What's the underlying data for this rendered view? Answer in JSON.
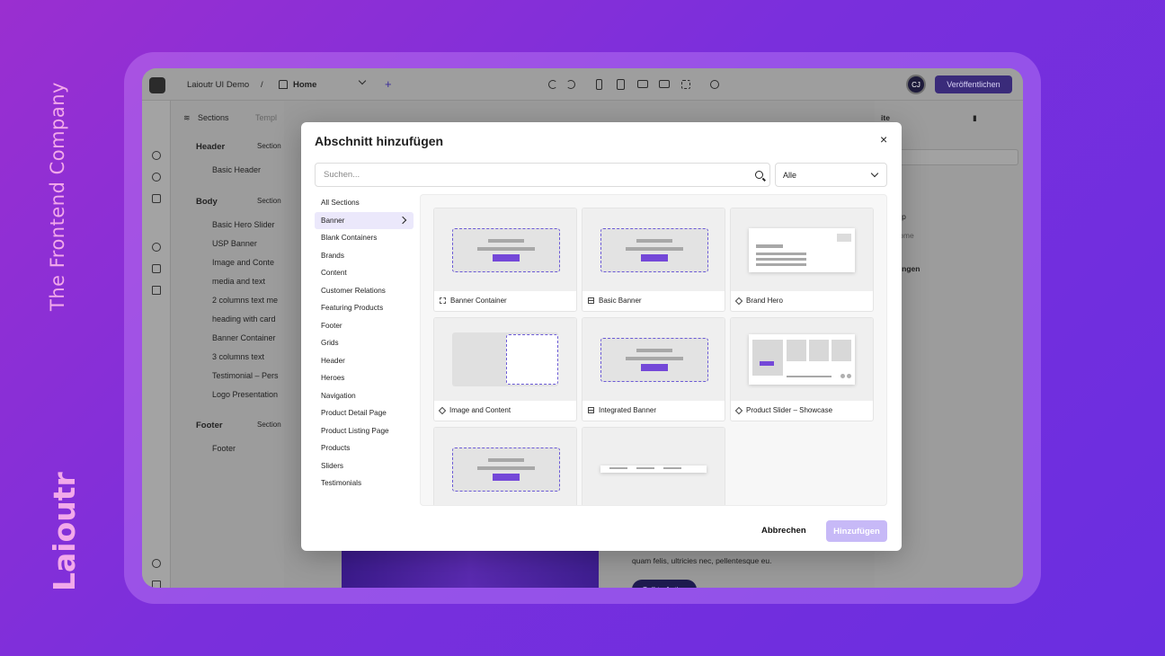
{
  "side": {
    "company": "The Frontend Company",
    "brand": "Laioutr"
  },
  "topbar": {
    "project": "Laioutr UI Demo",
    "separator": "/",
    "page": "Home",
    "add": "+",
    "avatar": "CJ",
    "publish": "Veröffentlichen"
  },
  "tree": {
    "tabs": [
      "Sections",
      "Templ"
    ],
    "sections": [
      {
        "title": "Header",
        "add": "Section",
        "items": [
          "Basic Header"
        ]
      },
      {
        "title": "Body",
        "add": "Section",
        "items": [
          "Basic Hero Slider",
          "USP Banner",
          "Image and Conte",
          "media and text",
          "2 columns text me",
          "heading with card",
          "Banner Container",
          "3 columns text",
          "Testimonial – Pers",
          "Logo Presentation"
        ]
      },
      {
        "title": "Footer",
        "add": "Section",
        "items": [
          "Footer"
        ]
      }
    ]
  },
  "rightpanel": {
    "title": "ite",
    "name_label": "me",
    "name_value": "ome",
    "url_label": "L",
    "type_label": "ntentyp",
    "type_value": "Home",
    "conditions": "dingungen",
    "seo": "O"
  },
  "canvas": {
    "text": "quam felis, ultricies nec, pellentesque eu.",
    "cta": "Call to Action"
  },
  "modal": {
    "title": "Abschnitt hinzufügen",
    "close": "×",
    "search_placeholder": "Suchen...",
    "filter": "Alle",
    "categories": [
      "All Sections",
      "Banner",
      "Blank Containers",
      "Brands",
      "Content",
      "Customer Relations",
      "Featuring Products",
      "Footer",
      "Grids",
      "Header",
      "Heroes",
      "Navigation",
      "Product Detail Page",
      "Product Listing Page",
      "Products",
      "Sliders",
      "Testimonials"
    ],
    "active_category": "Banner",
    "cards": [
      {
        "label": "Banner Container",
        "icon": "dashed-box-icon"
      },
      {
        "label": "Basic Banner",
        "icon": "grid-icon"
      },
      {
        "label": "Brand Hero",
        "icon": "diamond-icon"
      },
      {
        "label": "Image and Content",
        "icon": "diamond-icon"
      },
      {
        "label": "Integrated Banner",
        "icon": "grid-icon"
      },
      {
        "label": "Product Slider – Showcase",
        "icon": "diamond-icon"
      }
    ],
    "cancel": "Abbrechen",
    "add": "Hinzufügen"
  },
  "colors": {
    "accent": "#7448d8",
    "primary_dark": "#3a2b7a",
    "disabled_button": "#c7b9f7"
  }
}
